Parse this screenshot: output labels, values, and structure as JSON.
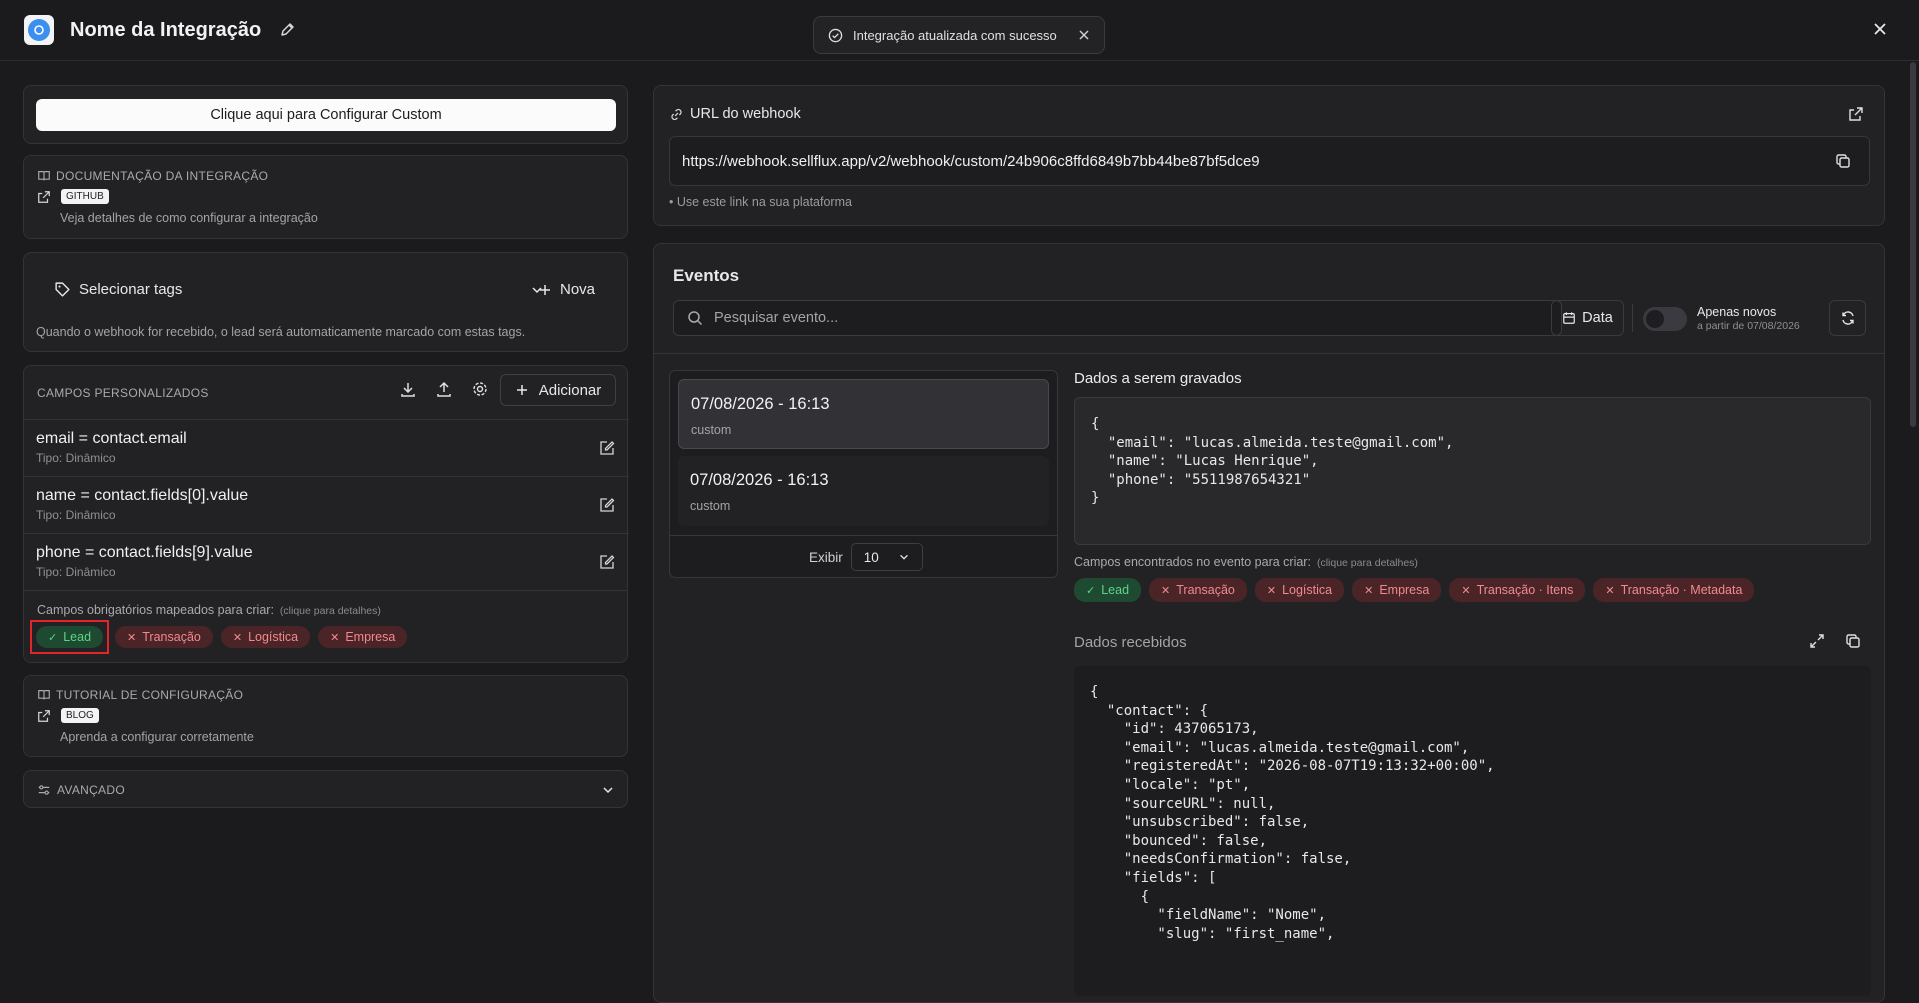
{
  "header": {
    "title": "Nome da Integração"
  },
  "toast": {
    "message": "Integração atualizada com sucesso"
  },
  "left": {
    "configure_button": "Clique aqui para Configurar Custom",
    "documentation": {
      "heading": "DOCUMENTAÇÃO DA INTEGRAÇÃO",
      "badge": "GITHUB",
      "description": "Veja detalhes de como configurar a integração"
    },
    "tags": {
      "select_label": "Selecionar tags",
      "new_label": "Nova",
      "hint": "Quando o webhook for recebido, o lead será automaticamente marcado com estas tags."
    },
    "custom_fields": {
      "heading": "CAMPOS PERSONALIZADOS",
      "add_label": "Adicionar",
      "items": [
        {
          "name": "email = contact.email",
          "type": "Tipo: Dinâmico"
        },
        {
          "name": "name = contact.fields[0].value",
          "type": "Tipo: Dinâmico"
        },
        {
          "name": "phone = contact.fields[9].value",
          "type": "Tipo: Dinâmico"
        }
      ],
      "required_label": "Campos obrigatórios mapeados para criar:",
      "required_hint": "(clique para detalhes)",
      "required_pills": [
        "Lead",
        "Transação",
        "Logística",
        "Empresa"
      ]
    },
    "tutorial": {
      "heading": "TUTORIAL DE CONFIGURAÇÃO",
      "badge": "BLOG",
      "description": "Aprenda a configurar corretamente"
    },
    "advanced": {
      "heading": "AVANÇADO"
    }
  },
  "webhook": {
    "label": "URL do webhook",
    "url": "https://webhook.sellflux.app/v2/webhook/custom/24b906c8ffd6849b7bb44be87bf5dce9",
    "hint": "• Use este link na sua plataforma"
  },
  "events": {
    "heading": "Eventos",
    "search_placeholder": "Pesquisar evento...",
    "date_button": "Data",
    "only_new_label": "Apenas novos",
    "only_new_sub": "a partir de 07/08/2026",
    "list": [
      {
        "datetime": "07/08/2026 - 16:13",
        "source": "custom"
      },
      {
        "datetime": "07/08/2026 - 16:13",
        "source": "custom"
      }
    ],
    "show_label": "Exibir",
    "show_value": "10"
  },
  "detail": {
    "to_save_heading": "Dados a serem gravados",
    "to_save_code": "{\n  \"email\": \"lucas.almeida.teste@gmail.com\",\n  \"name\": \"Lucas Henrique\",\n  \"phone\": \"5511987654321\"\n}",
    "found_label": "Campos encontrados no evento para criar:",
    "found_hint": "(clique para detalhes)",
    "found_pills": [
      "Lead",
      "Transação",
      "Logística",
      "Empresa",
      "Transação · Itens",
      "Transação · Metadata"
    ],
    "received_heading": "Dados recebidos",
    "received_code": "{\n  \"contact\": {\n    \"id\": 437065173,\n    \"email\": \"lucas.almeida.teste@gmail.com\",\n    \"registeredAt\": \"2026-08-07T19:13:32+00:00\",\n    \"locale\": \"pt\",\n    \"sourceURL\": null,\n    \"unsubscribed\": false,\n    \"bounced\": false,\n    \"needsConfirmation\": false,\n    \"fields\": [\n      {\n        \"fieldName\": \"Nome\",\n        \"slug\": \"first_name\","
  },
  "colors": {
    "background": "#1b1b1d",
    "card": "#222225",
    "success": "#5fd38a",
    "danger": "#f08a8f",
    "highlight": "#e0262b"
  }
}
